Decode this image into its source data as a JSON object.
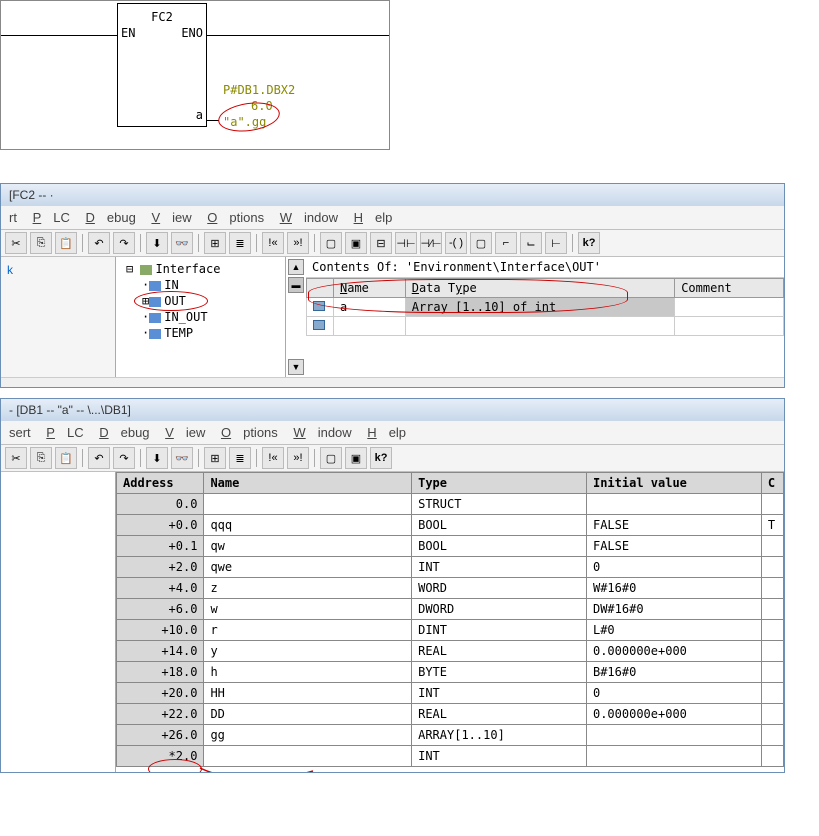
{
  "lad": {
    "block_title": "FC2",
    "en": "EN",
    "eno": "ENO",
    "out_param": "a",
    "pointer": "P#DB1.DBX2",
    "pointer2": "6.0",
    "actual": "\"a\".gg"
  },
  "fc2": {
    "title": "[FC2 -- ·",
    "menu": {
      "insert": "rt",
      "plc": "PLC",
      "debug": "Debug",
      "view": "View",
      "options": "Options",
      "window": "Window",
      "help": "Help"
    },
    "tree": {
      "root": "Interface",
      "items": [
        "IN",
        "OUT",
        "IN_OUT",
        "TEMP"
      ]
    },
    "contents_title": "Contents Of: 'Environment\\Interface\\OUT'",
    "table": {
      "headers": {
        "name": "Name",
        "type": "Data Type",
        "comment": "Comment"
      },
      "row_name": "a",
      "row_type": "Array [1..10] of int"
    },
    "left_link": "k"
  },
  "db1": {
    "title": "- [DB1 -- \"a\" --                 \\...\\DB1]",
    "menu": {
      "insert": "sert",
      "plc": "PLC",
      "debug": "Debug",
      "view": "View",
      "options": "Options",
      "window": "Window",
      "help": "Help"
    },
    "table": {
      "headers": {
        "addr": "Address",
        "name": "Name",
        "type": "Type",
        "init": "Initial value",
        "c": "C"
      },
      "rows": [
        {
          "addr": "0.0",
          "name": "",
          "type": "STRUCT",
          "init": "",
          "c": ""
        },
        {
          "addr": "+0.0",
          "name": "qqq",
          "type": "BOOL",
          "init": "FALSE",
          "c": "T"
        },
        {
          "addr": "+0.1",
          "name": "qw",
          "type": "BOOL",
          "init": "FALSE",
          "c": ""
        },
        {
          "addr": "+2.0",
          "name": "qwe",
          "type": "INT",
          "init": "0",
          "c": ""
        },
        {
          "addr": "+4.0",
          "name": "z",
          "type": "WORD",
          "init": "W#16#0",
          "c": ""
        },
        {
          "addr": "+6.0",
          "name": "w",
          "type": "DWORD",
          "init": "DW#16#0",
          "c": ""
        },
        {
          "addr": "+10.0",
          "name": "r",
          "type": "DINT",
          "init": "L#0",
          "c": ""
        },
        {
          "addr": "+14.0",
          "name": "y",
          "type": "REAL",
          "init": "0.000000e+000",
          "c": ""
        },
        {
          "addr": "+18.0",
          "name": "h",
          "type": "BYTE",
          "init": "B#16#0",
          "c": ""
        },
        {
          "addr": "+20.0",
          "name": "HH",
          "type": "INT",
          "init": "0",
          "c": ""
        },
        {
          "addr": "+22.0",
          "name": "DD",
          "type": "REAL",
          "init": "0.000000e+000",
          "c": ""
        },
        {
          "addr": "+26.0",
          "name": "gg",
          "type": "ARRAY[1..10]",
          "init": "",
          "c": ""
        },
        {
          "addr": "*2.0",
          "name": "",
          "type": "INT",
          "init": "",
          "c": ""
        }
      ]
    }
  },
  "glyphs": {
    "cut": "✂",
    "copy": "⎘",
    "paste": "📋",
    "undo": "↶",
    "redo": "↷",
    "help": "?",
    "helpk": "k?",
    "stream": "≣",
    "box": "▢",
    "tree": "⊞"
  }
}
